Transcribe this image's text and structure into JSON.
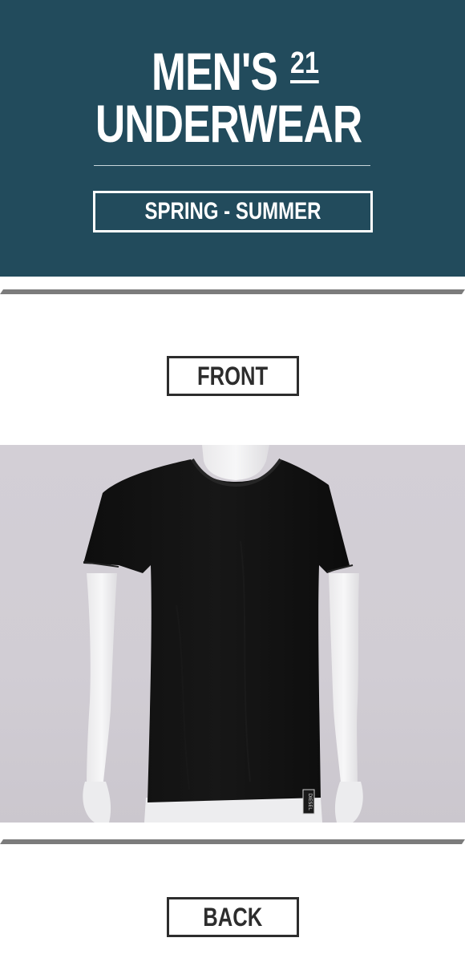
{
  "header": {
    "title_line1": "MEN'S",
    "title_superscript": "21",
    "title_line2": "UNDERWEAR",
    "season": "SPRING - SUMMER"
  },
  "sections": {
    "front_label": "FRONT",
    "back_label": "BACK"
  },
  "product_photo": {
    "tag_text": "DIESEL"
  },
  "colors": {
    "banner": "#224b5c",
    "divider": "#7c7c7c",
    "label_border": "#2d2d2d",
    "shirt": "#121212",
    "photo_background": "#d2ced5"
  }
}
